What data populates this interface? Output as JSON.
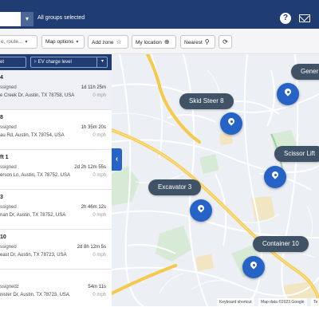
{
  "header": {
    "groups_label": "All groups selected",
    "help_icon": "help-icon",
    "mail_icon": "mail-icon",
    "group_caret": "▾"
  },
  "toolbar": {
    "search_placeholder": "e, route...",
    "map_options": "Map options",
    "add_zone": "Add zone",
    "my_location": "My location",
    "nearest": "Nearest",
    "caret": "▾",
    "add_zone_icon": "☆",
    "my_location_icon": "⊕",
    "nearest_icon": "⚲",
    "refresh_icon": "⟳"
  },
  "panel": {
    "filter_left": "et",
    "filter_right": "EV charge level",
    "caret": "▾",
    "collapse_icon": "‹",
    "assets": [
      {
        "name": "4",
        "status": "ssigned",
        "time": "1d 11h 25m",
        "address": "e Creek Dr, Austin, TX 78758, USA",
        "speed": "0 mph"
      },
      {
        "name": "8",
        "status": "ssigned",
        "time": "1h 35m 20s",
        "address": "au Rd, Austin, TX 78754, USA",
        "speed": "0 mph"
      },
      {
        "name": "ft 1",
        "status": "ssigned",
        "time": "2d 2h 12m 55s",
        "address": "erson Ln, Austin, TX 78752, USA",
        "speed": "0 mph"
      },
      {
        "name": "3",
        "status": "ssigned",
        "time": "2h 46m 12s",
        "address": "nan Dr, Austin, TX 78752, USA",
        "speed": "0 mph"
      },
      {
        "name": "10",
        "status": "ssigned",
        "time": "2d 8h 12m 5s",
        "address": "east Dr, Austin, TX 78723, USA",
        "speed": "0 mph"
      },
      {
        "name": "",
        "status": "ssignedz",
        "time": "54m 11s",
        "address": "nister Dr, Austin, TX 78723, USA",
        "speed": "0 mph"
      }
    ]
  },
  "map": {
    "labels": [
      "Gener",
      "Skid Steer 8",
      "Scissor Lift",
      "Excavator 3",
      "Container 10"
    ],
    "attribution": {
      "shortcuts": "Keyboard shortcut",
      "data": "Map data ©2023 Google",
      "terms": "Te"
    }
  },
  "colors": {
    "header_bg": "#1f3c73",
    "accent_blue": "#2663c7",
    "label_bg": "#3f5266",
    "highway": "#f5c94a",
    "park": "#cfe7cf",
    "water": "#aad3f2"
  }
}
